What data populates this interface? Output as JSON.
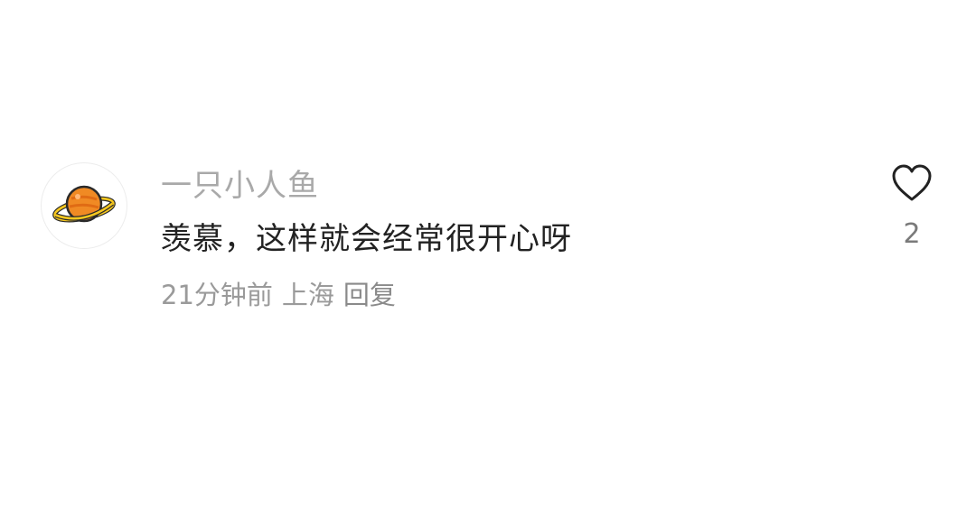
{
  "comment": {
    "avatar_icon": "planet-icon",
    "username": "一只小人鱼",
    "text": "羡慕，这样就会经常很开心呀",
    "time": "21分钟前",
    "location": "上海",
    "reply_label": "回复",
    "like_icon": "heart-outline-icon",
    "like_count": "2"
  },
  "colors": {
    "background": "#ffffff",
    "username": "#a9a9a9",
    "text": "#222222",
    "meta": "#9a9a9a",
    "planet": "#f08a24",
    "ring": "#f7c81e"
  }
}
